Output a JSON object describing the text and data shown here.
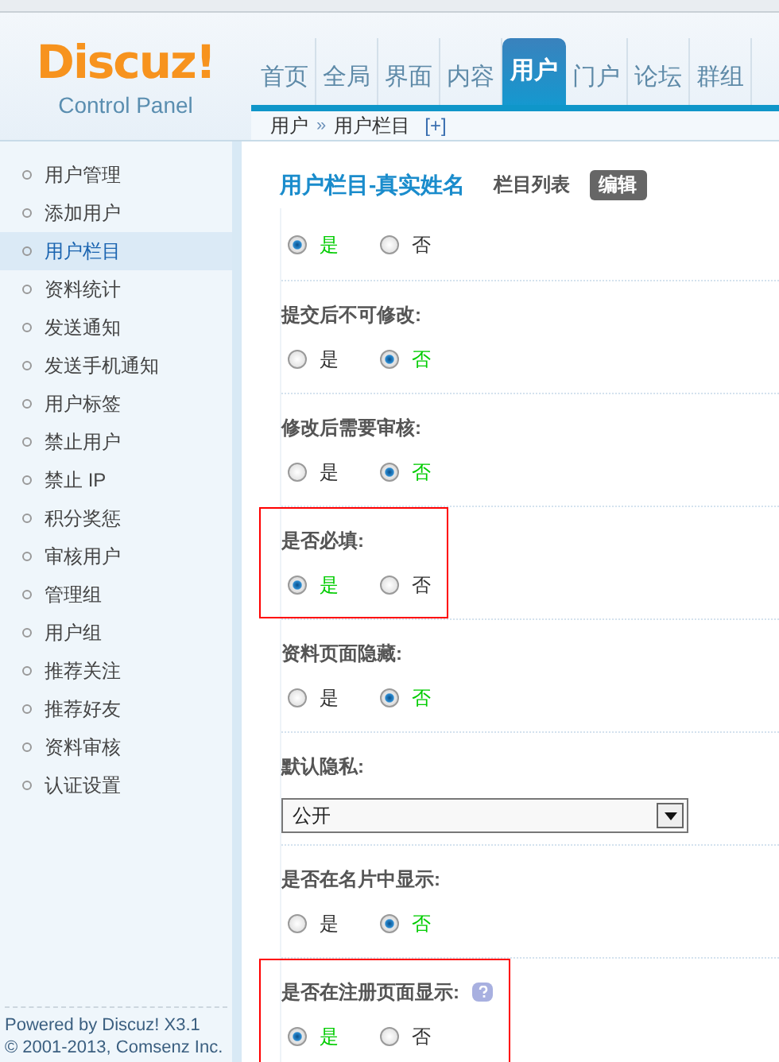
{
  "logo": {
    "brand": "Discuz!",
    "subtitle": "Control Panel"
  },
  "nav": [
    {
      "label": "首页",
      "selected": false
    },
    {
      "label": "全局",
      "selected": false
    },
    {
      "label": "界面",
      "selected": false
    },
    {
      "label": "内容",
      "selected": false
    },
    {
      "label": "用户",
      "selected": true
    },
    {
      "label": "门户",
      "selected": false
    },
    {
      "label": "论坛",
      "selected": false
    },
    {
      "label": "群组",
      "selected": false
    }
  ],
  "breadcrumb": {
    "items": [
      "用户",
      "用户栏目"
    ],
    "separator": "»",
    "add": "[+]"
  },
  "sidebar": {
    "items": [
      {
        "label": "用户管理",
        "selected": false
      },
      {
        "label": "添加用户",
        "selected": false
      },
      {
        "label": "用户栏目",
        "selected": true
      },
      {
        "label": "资料统计",
        "selected": false
      },
      {
        "label": "发送通知",
        "selected": false
      },
      {
        "label": "发送手机通知",
        "selected": false
      },
      {
        "label": "用户标签",
        "selected": false
      },
      {
        "label": "禁止用户",
        "selected": false
      },
      {
        "label": "禁止 IP",
        "selected": false
      },
      {
        "label": "积分奖惩",
        "selected": false
      },
      {
        "label": "审核用户",
        "selected": false
      },
      {
        "label": "管理组",
        "selected": false
      },
      {
        "label": "用户组",
        "selected": false
      },
      {
        "label": "推荐关注",
        "selected": false
      },
      {
        "label": "推荐好友",
        "selected": false
      },
      {
        "label": "资料审核",
        "selected": false
      },
      {
        "label": "认证设置",
        "selected": false
      }
    ],
    "footer": [
      "Powered by Discuz! X3.1",
      "© 2001-2013, Comsenz Inc."
    ]
  },
  "page": {
    "title": "用户栏目-真实姓名",
    "links": [
      "栏目列表"
    ],
    "active_tab": "编辑"
  },
  "fields": [
    {
      "kind": "radio",
      "highlighted": false,
      "options": [
        {
          "label": "是",
          "selected": true
        },
        {
          "label": "否",
          "selected": false
        }
      ]
    },
    {
      "kind": "radio",
      "label": "提交后不可修改:",
      "highlighted": false,
      "help": false,
      "options": [
        {
          "label": "是",
          "selected": false
        },
        {
          "label": "否",
          "selected": true
        }
      ]
    },
    {
      "kind": "radio",
      "label": "修改后需要审核:",
      "highlighted": false,
      "help": false,
      "options": [
        {
          "label": "是",
          "selected": false
        },
        {
          "label": "否",
          "selected": true
        }
      ]
    },
    {
      "kind": "radio",
      "label": "是否必填:",
      "highlighted": true,
      "help": false,
      "options": [
        {
          "label": "是",
          "selected": true
        },
        {
          "label": "否",
          "selected": false
        }
      ]
    },
    {
      "kind": "radio",
      "label": "资料页面隐藏:",
      "highlighted": false,
      "help": false,
      "options": [
        {
          "label": "是",
          "selected": false
        },
        {
          "label": "否",
          "selected": true
        }
      ]
    },
    {
      "kind": "select",
      "label": "默认隐私:",
      "highlighted": false,
      "help": false,
      "value": "公开"
    },
    {
      "kind": "radio",
      "label": "是否在名片中显示:",
      "highlighted": false,
      "help": false,
      "options": [
        {
          "label": "是",
          "selected": false
        },
        {
          "label": "否",
          "selected": true
        }
      ]
    },
    {
      "kind": "radio",
      "label": "是否在注册页面显示:",
      "highlighted": true,
      "help": true,
      "options": [
        {
          "label": "是",
          "selected": true
        },
        {
          "label": "否",
          "selected": false
        }
      ]
    }
  ]
}
